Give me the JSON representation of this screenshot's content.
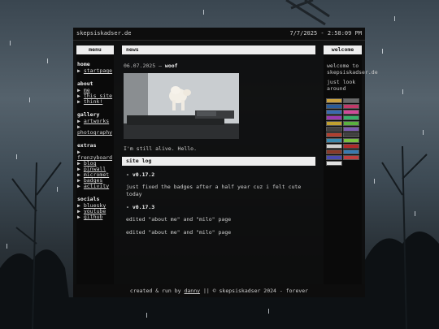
{
  "topbar": {
    "domain": "skepsiskadser.de",
    "clock": "7/7/2025 - 2:58:09 PM"
  },
  "menu": {
    "title": "menu",
    "groups": [
      {
        "title": "home",
        "items": [
          {
            "label": "startpage"
          }
        ]
      },
      {
        "title": "about",
        "items": [
          {
            "label": "me"
          },
          {
            "label": "this site"
          },
          {
            "label": "think!"
          }
        ]
      },
      {
        "title": "gallery",
        "items": [
          {
            "label": "artworks"
          },
          {
            "label": "photography"
          }
        ]
      },
      {
        "title": "extras",
        "items": [
          {
            "label": "frenzyboard"
          },
          {
            "label": "blog"
          },
          {
            "label": "pinwall"
          },
          {
            "label": "micromet"
          },
          {
            "label": "badges"
          },
          {
            "label": "activity"
          }
        ]
      },
      {
        "title": "socials",
        "items": [
          {
            "label": "bluesky"
          },
          {
            "label": "youtube"
          },
          {
            "label": "github"
          }
        ]
      }
    ],
    "bullet": "▶"
  },
  "news": {
    "title": "news",
    "date": "06.07.2025",
    "separator": "—",
    "post_title": "woof",
    "text": "I'm still alive. Hello."
  },
  "sitelog": {
    "title": "site log",
    "entries": [
      {
        "version": "- v0.17.2",
        "text": "just fixed the badges after a half year cuz i felt cute today"
      },
      {
        "version": "- v0.17.3",
        "text": "edited \"about me\" and \"milo\" page"
      },
      {
        "version": "",
        "text": "edited \"about me\" and \"milo\" page"
      }
    ]
  },
  "welcome": {
    "title": "welcome",
    "line1": "welcome to skepsiskadser.de",
    "line2": "just look around"
  },
  "badge_colors": [
    "#c8a040",
    "#6a6a6a",
    "#2a5c9a",
    "#c23a6a",
    "#3a6ab0",
    "#d04a9a",
    "#9a3ab0",
    "#3ab06a",
    "#c0a030",
    "#5ab040",
    "#404040",
    "#7a5ab0",
    "#b04030",
    "#404040",
    "#3a8ab0",
    "#7ac040",
    "#d0d0d0",
    "#b02a2a",
    "#8a3a2a",
    "#3a7ab0",
    "#4a4ab0",
    "#c04040",
    "#e0e0e0"
  ],
  "footer": {
    "prefix": "created & run by",
    "author": "danny",
    "suffix": "|| © skepsiskadser 2024 - forever"
  }
}
